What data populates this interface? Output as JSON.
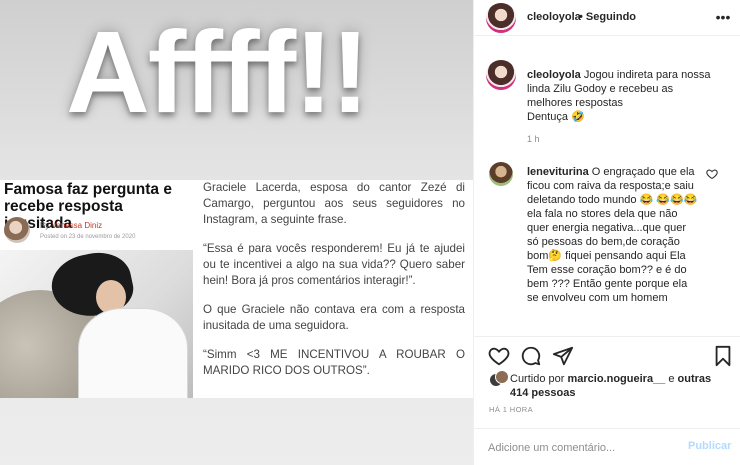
{
  "post_image": {
    "big_text": "Affff!!",
    "article": {
      "title": "Famosa faz pergunta e recebe resposta inusitada",
      "by": "By ",
      "author": "Vanessa Diniz",
      "date": "Posted on 23 de novembro de 2020",
      "paragraphs": [
        "Graciele Lacerda, esposa do cantor Zezé di Camargo, perguntou aos seus seguidores no Instagram, a seguinte frase.",
        "“Essa é para vocês responderem! Eu já te ajudei ou te incentivei a algo na sua vida?? Quero saber hein! Bora já pros comentários interagir!”.",
        "O que Graciele não contava era com a resposta inusitada de uma seguidora.",
        "“Simm <3 ME INCENTIVOU A ROUBAR O MARIDO RICO DOS OUTROS”."
      ]
    }
  },
  "header": {
    "username": "cleoloyola",
    "follow_status": "• Seguindo",
    "more_icon": "more-horizontal-icon"
  },
  "caption": {
    "username": "cleoloyola",
    "text": " Jogou indireta para nossa linda Zilu Godoy e recebeu as melhores respostas",
    "text2": "Dentuça 🤣",
    "time": "1 h"
  },
  "comment": {
    "username": "leneviturina",
    "text": " O engraçado que ela ficou com raiva da resposta;e saiu deletando todo mundo 😂 😂😂😂 ela fala no stores dela que não quer energia negativa...que quer só pessoas do bem,de coração bom🤔 fiquei pensando aqui Ela Tem esse coração bom?? e é do bem ??? Então gente porque ela se envolveu com um homem"
  },
  "likes": {
    "prefix": "Curtido por ",
    "user": "marcio.nogueira__",
    "mid": " e ",
    "others": "outras 414 pessoas"
  },
  "time_ago": "HÁ 1 HORA",
  "comment_box": {
    "placeholder": "Adicione um comentário...",
    "publish_label": "Publicar"
  }
}
